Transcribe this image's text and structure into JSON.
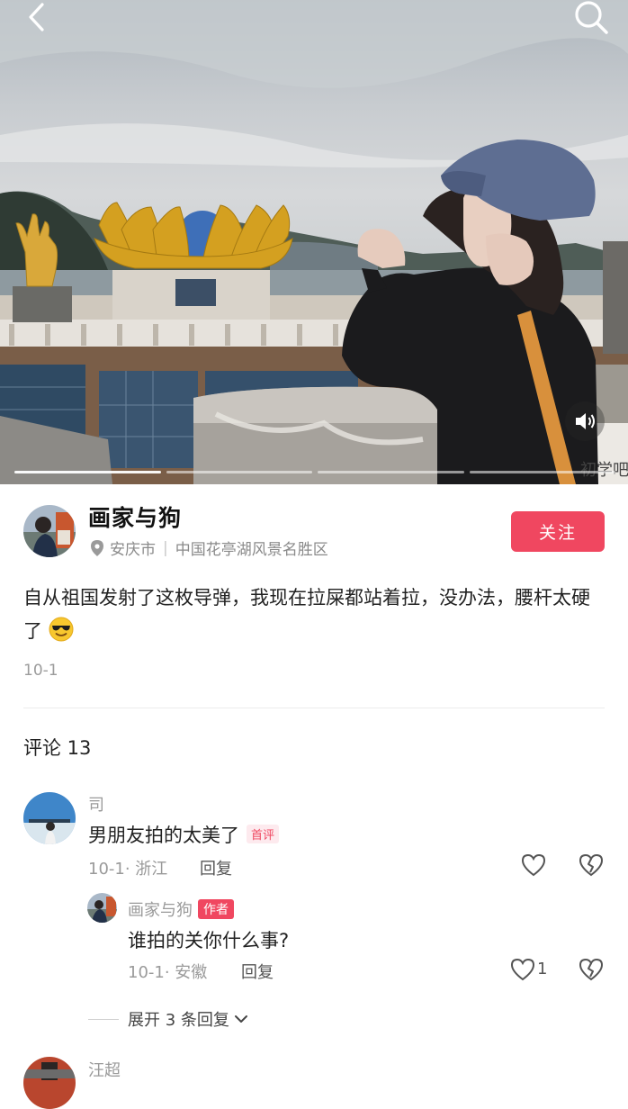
{
  "header": {
    "back_icon": "chevron-left-icon",
    "search_icon": "search-icon",
    "sound_icon": "speaker-icon"
  },
  "media": {
    "slides_total": 4,
    "slide_active": 1,
    "sign_text": "初学吧"
  },
  "author": {
    "name": "画家与狗",
    "location_icon": "location-pin-icon",
    "city": "安庆市",
    "place": "中国花亭湖风景名胜区",
    "follow_label": "关注"
  },
  "post": {
    "text": "自从祖国发射了这枚导弹，我现在拉屎都站着拉，没办法，腰杆太硬了",
    "emoji": "sunglasses-emoji",
    "date": "10-1"
  },
  "comments": {
    "title": "评论 13",
    "items": [
      {
        "username": "司",
        "text": "男朋友拍的太美了",
        "badge": "首评",
        "meta": "10-1· 浙江",
        "reply_label": "回复",
        "likes": ""
      }
    ],
    "reply": {
      "username": "画家与狗",
      "badge": "作者",
      "text": "谁拍的关你什么事?",
      "meta": "10-1· 安徽",
      "reply_label": "回复",
      "likes": "1"
    },
    "expand_label": "展开 3 条回复",
    "next_username": "汪超"
  },
  "colors": {
    "accent": "#f04760",
    "muted": "#9a9a9a"
  }
}
